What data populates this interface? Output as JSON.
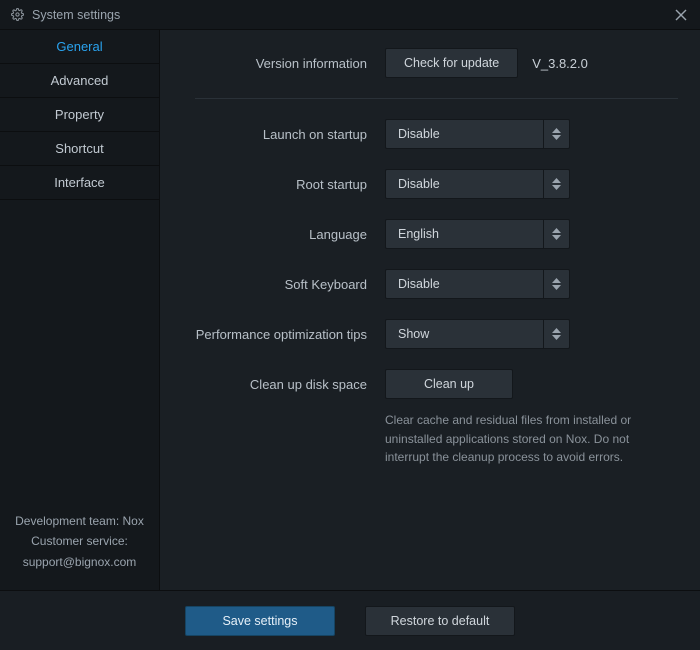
{
  "window": {
    "title": "System settings"
  },
  "sidebar": {
    "tabs": [
      {
        "label": "General"
      },
      {
        "label": "Advanced"
      },
      {
        "label": "Property"
      },
      {
        "label": "Shortcut"
      },
      {
        "label": "Interface"
      }
    ],
    "footer": {
      "dev_team": "Development team: Nox",
      "customer_service": "Customer service:",
      "support_email": "support@bignox.com"
    }
  },
  "general": {
    "version_label": "Version information",
    "check_update_btn": "Check for update",
    "version_value": "V_3.8.2.0",
    "launch_startup_label": "Launch on startup",
    "launch_startup_value": "Disable",
    "root_startup_label": "Root startup",
    "root_startup_value": "Disable",
    "language_label": "Language",
    "language_value": "English",
    "soft_keyboard_label": "Soft Keyboard",
    "soft_keyboard_value": "Disable",
    "perf_tips_label": "Performance optimization tips",
    "perf_tips_value": "Show",
    "cleanup_label": "Clean up disk space",
    "cleanup_btn": "Clean up",
    "cleanup_desc": "Clear cache and residual files from installed or uninstalled applications stored on Nox. Do not interrupt the cleanup process to avoid errors."
  },
  "footer": {
    "save_btn": "Save settings",
    "restore_btn": "Restore to default"
  }
}
